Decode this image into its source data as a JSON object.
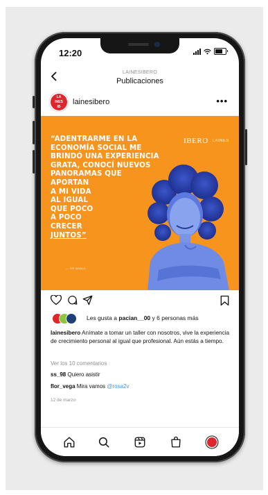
{
  "status_bar": {
    "time": "12:20"
  },
  "header": {
    "username": "LAINESIBERO",
    "title": "Publicaciones",
    "back_icon": "chevron-left-icon"
  },
  "account": {
    "avatar_text": [
      "LA",
      "INES",
      "IB"
    ],
    "name": "lainesibero",
    "more_icon": "more-horizontal-icon"
  },
  "post_image": {
    "quote_lines": [
      "“Adentrarme en la",
      "economía social me",
      "brindó una experiencia",
      "grata, conocí nuevos",
      "panoramas que",
      "aportan",
      "a mi vida",
      "al igual",
      "que poco",
      "a poco",
      "crecer",
      "juntos”"
    ],
    "signature": "— DE ADALÍ,",
    "logo_left": "IBERO",
    "logo_right": "LAINES",
    "background": "#f7941d"
  },
  "actions": {
    "like_icon": "heart-icon",
    "comment_icon": "comment-icon",
    "share_icon": "send-icon",
    "save_icon": "bookmark-icon"
  },
  "likes": {
    "prefix": "Les gusta a ",
    "user": "pacian__00",
    "suffix": " y 6 personas más",
    "avatar_colors": [
      "#e0262d",
      "#8cc63f",
      "#1f3f77"
    ]
  },
  "caption": {
    "user": "lainesibero",
    "text": " Anímate a tomar un taller con nosotros, vive la experiencia de crecimiento personal al igual que profesional. Aún estás a tiempo."
  },
  "view_comments": "Ver los 10 comentarios",
  "comments": [
    {
      "user": "ss_98",
      "text": " Quiero asistir",
      "mention": ""
    },
    {
      "user": "flor_vega",
      "text": " Mira vamos ",
      "mention": "@rosa2v"
    }
  ],
  "date": "12 de marzo",
  "tabbar": [
    "home-icon",
    "search-icon",
    "reels-icon",
    "shop-icon",
    "profile-icon"
  ]
}
